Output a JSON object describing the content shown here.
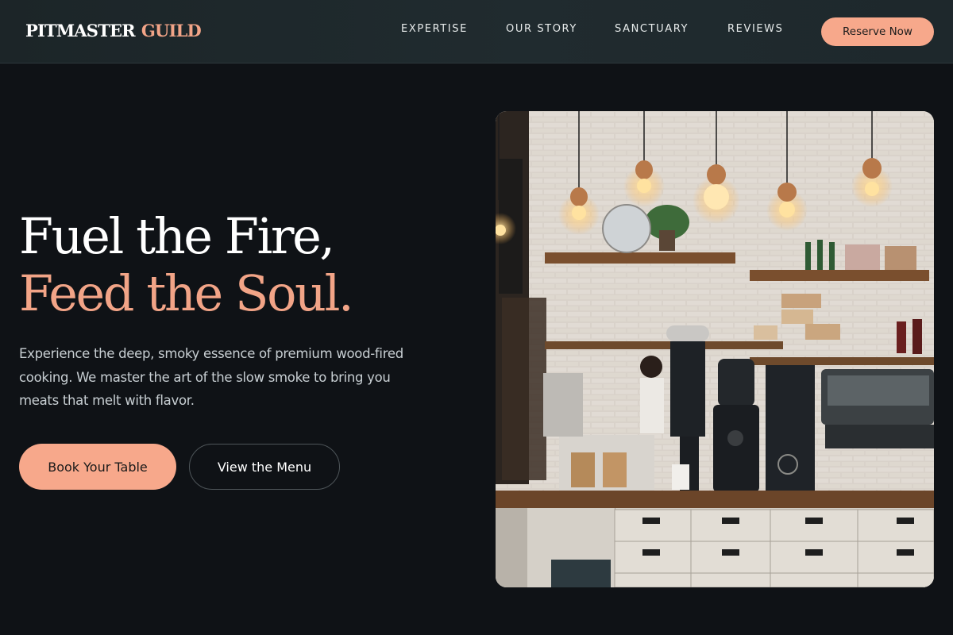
{
  "brand": {
    "name_part1": "PITMASTER",
    "name_part2": "GUILD"
  },
  "nav": {
    "links": [
      "EXPERTISE",
      "OUR STORY",
      "SANCTUARY",
      "REVIEWS"
    ],
    "cta_label": "Reserve Now"
  },
  "hero": {
    "title_line1": "Fuel the Fire,",
    "title_line2": "Feed the Soul.",
    "description": "Experience the deep, smoky essence of premium wood-fired cooking. We master the art of the slow smoke to bring you meats that melt with flavor.",
    "primary_button": "Book Your Table",
    "secondary_button": "View the Menu"
  },
  "colors": {
    "background": "#0f1216",
    "header_background": "#1f292d",
    "accent": "#f7a88b",
    "accent_text": "#f2a487",
    "body_text": "#c8cfd3"
  }
}
